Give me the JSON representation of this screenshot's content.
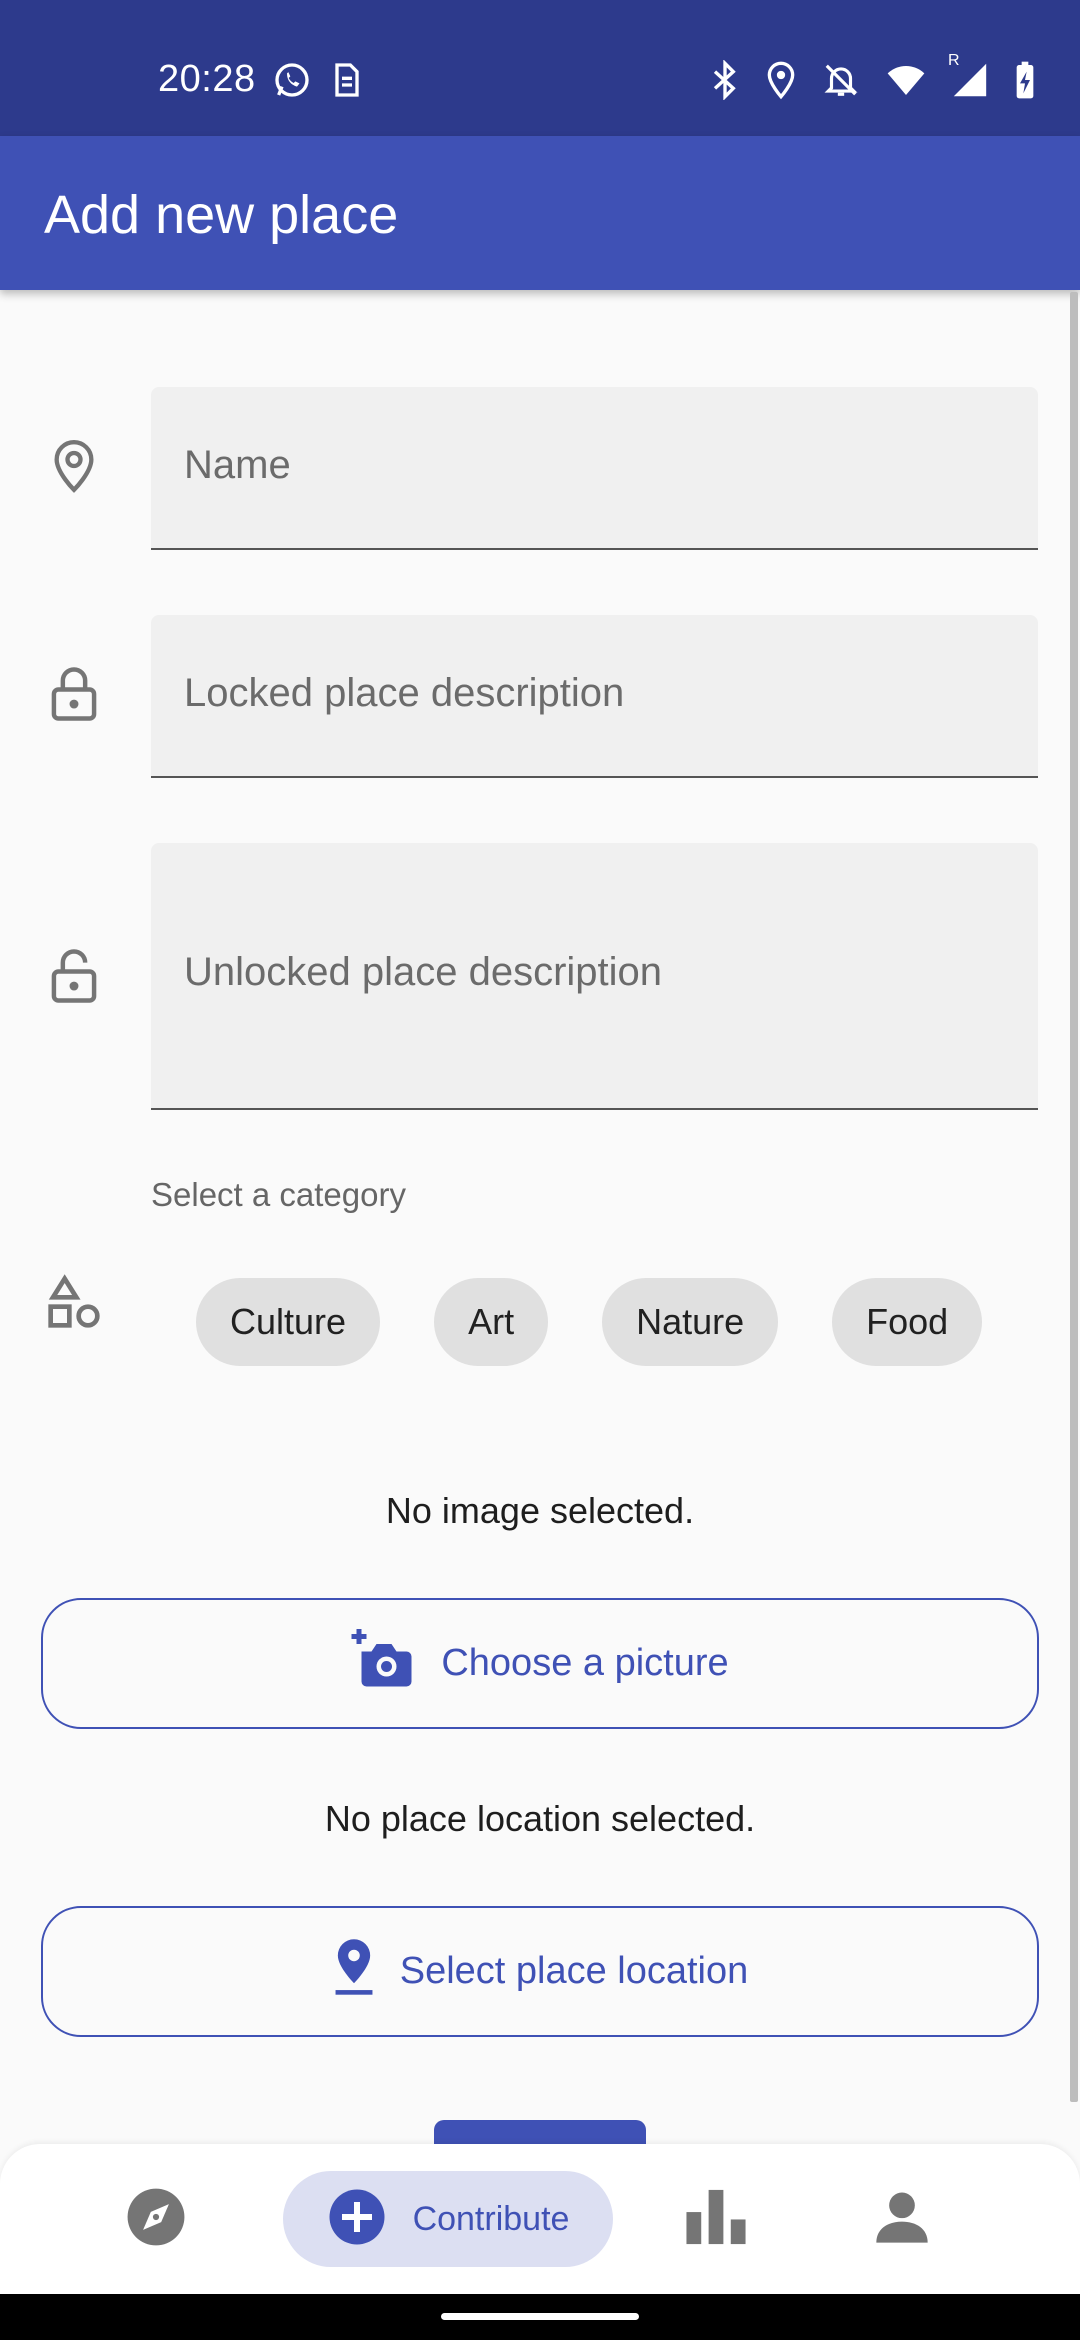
{
  "status_bar": {
    "time": "20:28",
    "left_icons": [
      "whatsapp-icon",
      "sim-icon"
    ],
    "right_icons": [
      "bluetooth-icon",
      "location-icon",
      "notifications-off-icon",
      "wifi-icon",
      "signal-icon",
      "battery-charging-icon"
    ],
    "signal_roaming_label": "R"
  },
  "app_bar": {
    "title": "Add new place"
  },
  "form": {
    "name_placeholder": "Name",
    "locked_description_placeholder": "Locked place description",
    "unlocked_description_placeholder": "Unlocked place description",
    "category_caption": "Select a category",
    "categories": [
      "Culture",
      "Art",
      "Nature",
      "Food"
    ],
    "image_status": "No image selected.",
    "choose_picture_label": "Choose a picture",
    "location_status": "No place location selected.",
    "select_location_label": "Select place location"
  },
  "bottom_nav": {
    "items": [
      {
        "icon": "explore-icon",
        "label": ""
      },
      {
        "icon": "add-circle-icon",
        "label": "Contribute",
        "selected": true
      },
      {
        "icon": "bar-chart-icon",
        "label": ""
      },
      {
        "icon": "person-icon",
        "label": ""
      }
    ]
  },
  "colors": {
    "status_bar": "#2d3a8c",
    "app_bar": "#3f51b5",
    "accent": "#3f51b5",
    "nav_selected_pill": "#dcdff2",
    "field_fill": "#f0f0f0",
    "chip_fill": "#e0e0e0"
  }
}
